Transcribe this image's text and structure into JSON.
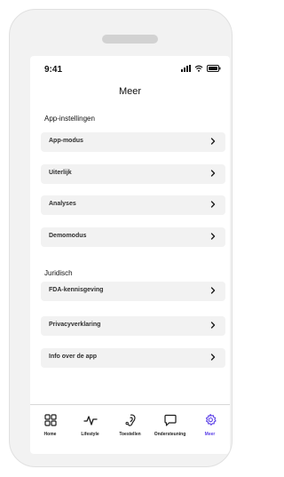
{
  "status_bar": {
    "time": "9:41"
  },
  "header": {
    "title": "Meer"
  },
  "sections": {
    "app_settings": {
      "title": "App-instellingen",
      "items": [
        {
          "label": "App-modus",
          "icon": "chevron-right-icon"
        },
        {
          "label": "Uiterlijk",
          "icon": "chevron-right-icon"
        },
        {
          "label": "Analyses",
          "icon": "chevron-right-icon"
        },
        {
          "label": "Demomodus",
          "icon": "chevron-right-icon"
        }
      ]
    },
    "legal": {
      "title": "Juridisch",
      "items": [
        {
          "label": "FDA-kennisgeving",
          "icon": "chevron-right-icon"
        },
        {
          "label": "Privacyverklaring",
          "icon": "chevron-right-icon"
        },
        {
          "label": "Info over de app",
          "icon": "chevron-right-icon"
        }
      ]
    }
  },
  "bottom_nav": {
    "items": [
      {
        "label": "Home",
        "icon": "home-grid-icon",
        "active": false
      },
      {
        "label": "Lifestyle",
        "icon": "lifestyle-pulse-icon",
        "active": false
      },
      {
        "label": "Toestellen",
        "icon": "hearing-aid-icon",
        "active": false
      },
      {
        "label": "Ondersteuning",
        "icon": "chat-bubble-icon",
        "active": false
      },
      {
        "label": "Meer",
        "icon": "gear-icon",
        "active": true
      }
    ]
  },
  "colors": {
    "accent": "#5b3fe7",
    "item_background": "#f2f2f2",
    "text_primary": "#1c1c1c"
  }
}
